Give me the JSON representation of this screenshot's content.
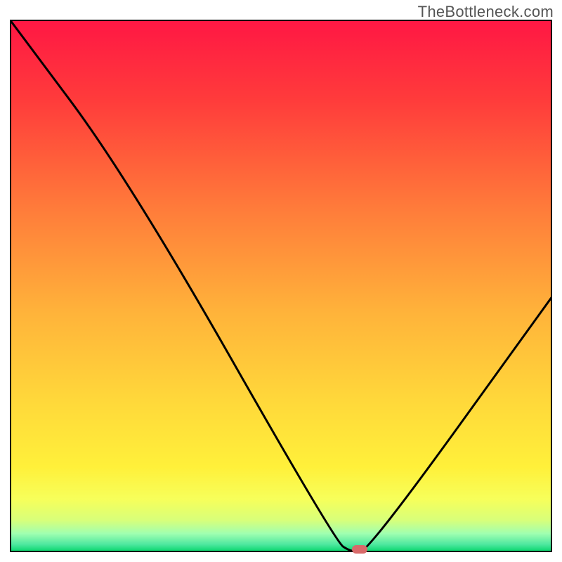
{
  "watermark": "TheBottleneck.com",
  "chart_data": {
    "type": "line",
    "title": "",
    "xlabel": "",
    "ylabel": "",
    "xlim": [
      0,
      100
    ],
    "ylim": [
      0,
      100
    ],
    "series": [
      {
        "name": "bottleneck-curve",
        "x": [
          0,
          22,
          60,
          63,
          66,
          100
        ],
        "values": [
          100,
          70,
          2,
          0,
          0,
          48
        ]
      }
    ],
    "marker": {
      "x": 64.5,
      "y": 0
    },
    "gradient_stops": [
      {
        "offset": 0.0,
        "color": "#ff1744"
      },
      {
        "offset": 0.15,
        "color": "#ff3b3b"
      },
      {
        "offset": 0.35,
        "color": "#ff7a3a"
      },
      {
        "offset": 0.55,
        "color": "#ffb33a"
      },
      {
        "offset": 0.72,
        "color": "#ffd93a"
      },
      {
        "offset": 0.84,
        "color": "#fff03a"
      },
      {
        "offset": 0.9,
        "color": "#f7ff5a"
      },
      {
        "offset": 0.94,
        "color": "#d8ff7a"
      },
      {
        "offset": 0.965,
        "color": "#a0ffb0"
      },
      {
        "offset": 0.985,
        "color": "#50e8a0"
      },
      {
        "offset": 1.0,
        "color": "#00d568"
      }
    ]
  }
}
